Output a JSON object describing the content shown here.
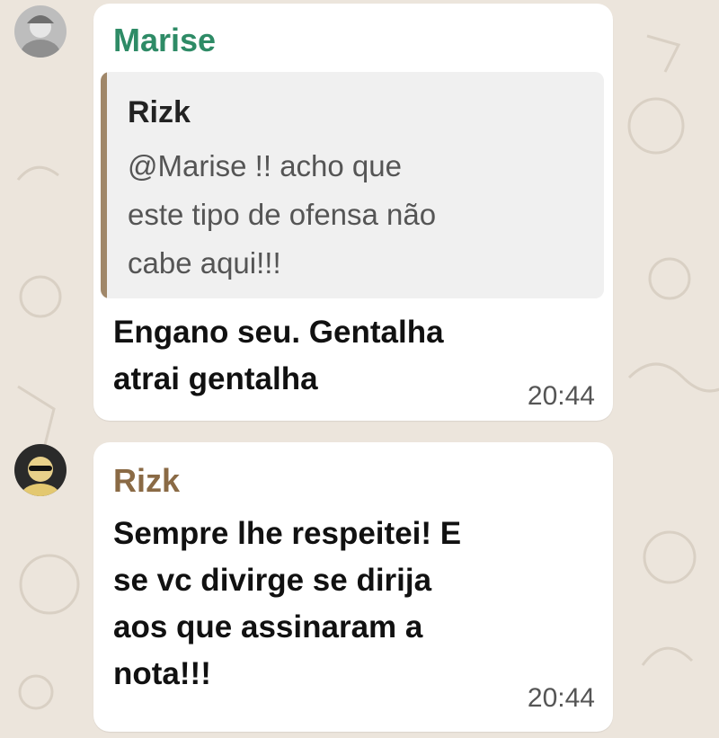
{
  "chat": {
    "messages": [
      {
        "sender": "Marise",
        "quote": {
          "author": "Rizk",
          "text": "@Marise  !! acho que\neste tipo de ofensa não\ncabe aqui!!!"
        },
        "text": "Engano seu. Gentalha\natrai gentalha",
        "time": "20:44",
        "avatar_icon": "user-avatar-marise"
      },
      {
        "sender": "Rizk",
        "text": "Sempre lhe respeitei! E\nse vc divirge se dirija\naos que assinaram a\nnota!!!",
        "time": "20:44",
        "avatar_icon": "user-avatar-rizk"
      }
    ]
  },
  "colors": {
    "chat_background": "#ece5dc",
    "bubble": "#ffffff",
    "sender_marise": "#2e8b66",
    "sender_rizk": "#8a6a45",
    "quote_bar": "#a08769"
  }
}
